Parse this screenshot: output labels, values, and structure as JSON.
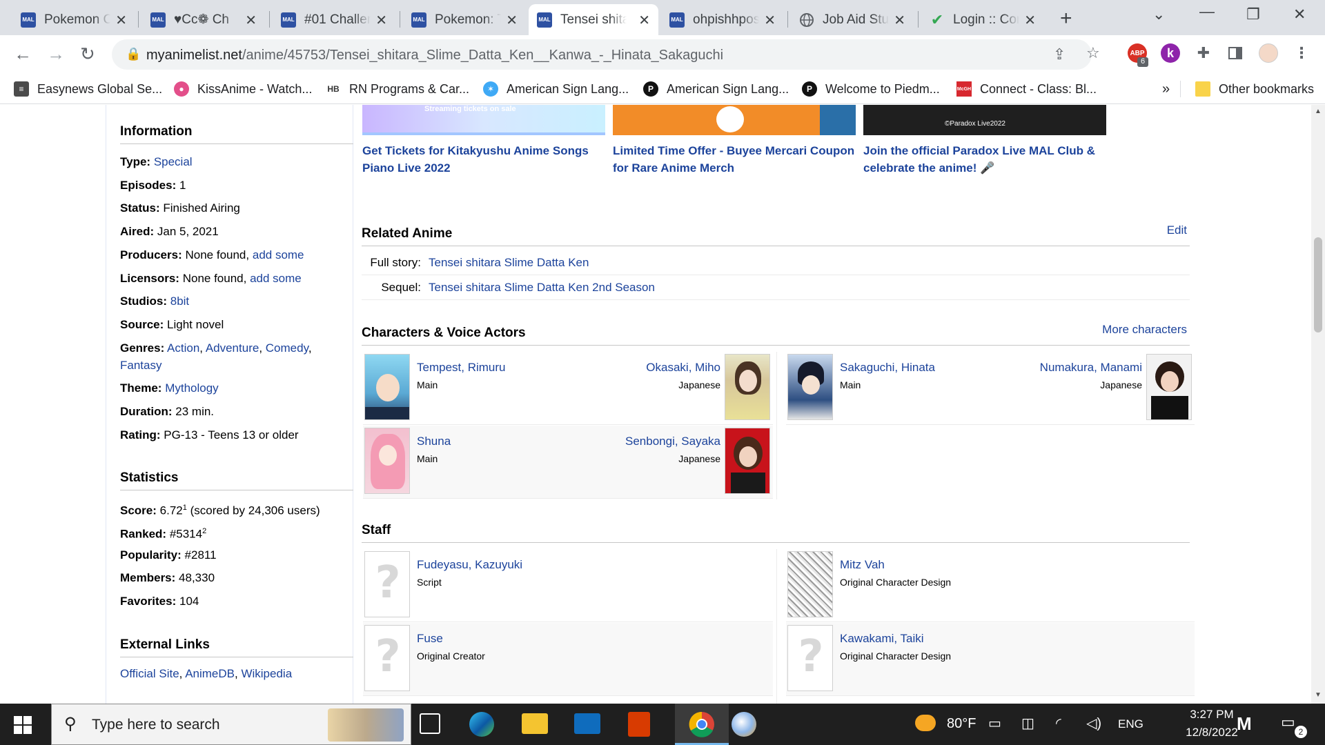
{
  "tabs": [
    {
      "title": "Pokemon C",
      "icon": "mal-icon"
    },
    {
      "title": "♥Cc❁ Ch",
      "icon": "mal-icon"
    },
    {
      "title": "#01 Challen",
      "icon": "mal-icon"
    },
    {
      "title": "Pokemon: T",
      "icon": "mal-icon"
    },
    {
      "title": "Tensei shita",
      "icon": "mal-icon",
      "active": true
    },
    {
      "title": "ohpishhpos",
      "icon": "mal-icon"
    },
    {
      "title": "Job Aid Stu",
      "icon": "globe-icon"
    },
    {
      "title": "Login :: Con",
      "icon": "check-icon"
    }
  ],
  "tab_icon_text": "MAL",
  "address": {
    "host": "myanimelist.net",
    "path": "/anime/45753/Tensei_shitara_Slime_Datta_Ken__Kanwa_-_Hinata_Sakaguchi"
  },
  "extensions": {
    "abp_badge": "6",
    "k_label": "k",
    "abp_label": "ABP"
  },
  "bookmarks": [
    {
      "label": "Easynews Global Se...",
      "icon": "easynews-icon",
      "color": "#4b4b4b"
    },
    {
      "label": "KissAnime - Watch...",
      "icon": "kissanime-icon",
      "color": "#e34f8a"
    },
    {
      "label": "RN Programs & Car...",
      "icon": "hb-icon",
      "color": "#333333"
    },
    {
      "label": "American Sign Lang...",
      "icon": "asl-icon",
      "color": "#3fa9f5"
    },
    {
      "label": "American Sign Lang...",
      "icon": "p-icon",
      "color": "#111111"
    },
    {
      "label": "Welcome to Piedm...",
      "icon": "p-icon",
      "color": "#111111"
    },
    {
      "label": "Connect - Class: Bl...",
      "icon": "mcgraw-icon",
      "color": "#d7282f"
    }
  ],
  "bookmarks_more": "»",
  "other_bookmarks": "Other bookmarks",
  "info": {
    "heading": "Information",
    "type_label": "Type:",
    "type": "Special",
    "episodes_label": "Episodes:",
    "episodes": "1",
    "status_label": "Status:",
    "status": "Finished Airing",
    "aired_label": "Aired:",
    "aired": "Jan 5, 2021",
    "producers_label": "Producers:",
    "producers": "None found,",
    "producers_link": "add some",
    "licensors_label": "Licensors:",
    "licensors": "None found,",
    "licensors_link": "add some",
    "studios_label": "Studios:",
    "studios": "8bit",
    "source_label": "Source:",
    "source": "Light novel",
    "genres_label": "Genres:",
    "genres": [
      "Action",
      "Adventure",
      "Comedy",
      "Fantasy"
    ],
    "theme_label": "Theme:",
    "theme": "Mythology",
    "duration_label": "Duration:",
    "duration": "23 min.",
    "rating_label": "Rating:",
    "rating": "PG-13 - Teens 13 or older"
  },
  "stats": {
    "heading": "Statistics",
    "score_label": "Score:",
    "score": "6.72",
    "score_sup": "1",
    "score_note": "(scored by 24,306 users)",
    "ranked_label": "Ranked:",
    "ranked": "#5314",
    "ranked_sup": "2",
    "popularity_label": "Popularity:",
    "popularity": "#2811",
    "members_label": "Members:",
    "members": "48,330",
    "favorites_label": "Favorites:",
    "favorites": "104"
  },
  "external": {
    "heading": "External Links",
    "links": [
      "Official Site",
      "AnimeDB",
      "Wikipedia"
    ]
  },
  "ads": [
    {
      "text": "Get Tickets for Kitakyushu Anime Songs Piano Live 2022",
      "banner": "Streaming tickets on sale"
    },
    {
      "text": "Limited Time Offer - Buyee Mercari Coupon for Rare Anime Merch",
      "banner": ""
    },
    {
      "text": "Join the official Paradox Live MAL Club & celebrate the anime! 🎤",
      "banner": "©Paradox Live2022"
    }
  ],
  "related": {
    "heading": "Related Anime",
    "edit": "Edit",
    "rows": [
      {
        "label": "Full story:",
        "value": "Tensei shitara Slime Datta Ken"
      },
      {
        "label": "Sequel:",
        "value": "Tensei shitara Slime Datta Ken 2nd Season"
      }
    ]
  },
  "characters": {
    "heading": "Characters & Voice Actors",
    "more": "More characters",
    "entries": [
      {
        "name": "Tempest, Rimuru",
        "role": "Main",
        "va": "Okasaki, Miho",
        "lang": "Japanese"
      },
      {
        "name": "Sakaguchi, Hinata",
        "role": "Main",
        "va": "Numakura, Manami",
        "lang": "Japanese"
      },
      {
        "name": "Shuna",
        "role": "Main",
        "va": "Senbongi, Sayaka",
        "lang": "Japanese"
      }
    ]
  },
  "staff": {
    "heading": "Staff",
    "entries": [
      {
        "name": "Fudeyasu, Kazuyuki",
        "role": "Script"
      },
      {
        "name": "Mitz Vah",
        "role": "Original Character Design"
      },
      {
        "name": "Fuse",
        "role": "Original Creator"
      },
      {
        "name": "Kawakami, Taiki",
        "role": "Original Character Design"
      }
    ]
  },
  "taskbar": {
    "search_placeholder": "Type here to search",
    "weather": "80°F",
    "lang": "ENG",
    "time": "3:27 PM",
    "date": "12/8/2022",
    "notif_count": "2"
  }
}
